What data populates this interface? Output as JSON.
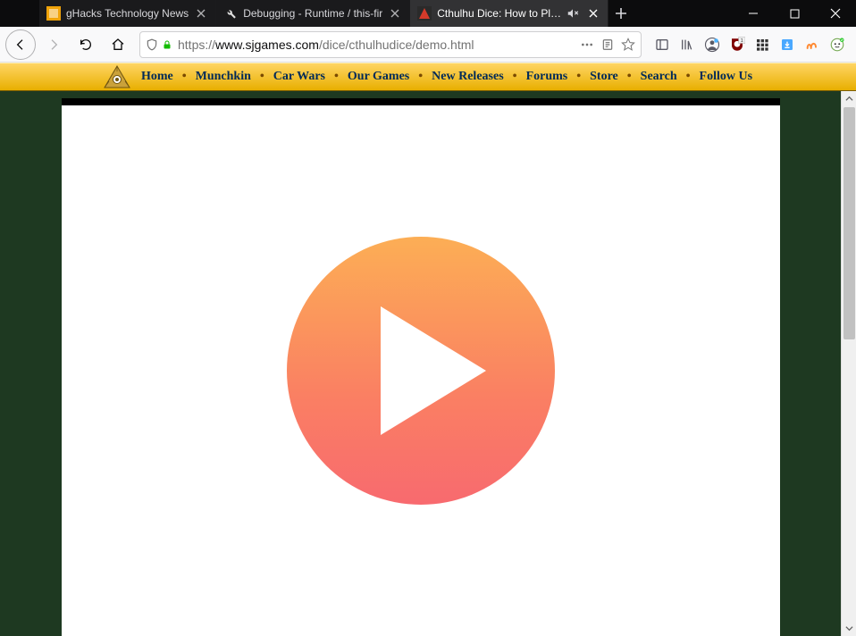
{
  "browser": {
    "tabs": [
      {
        "title": "gHacks Technology News",
        "active": false
      },
      {
        "title": "Debugging - Runtime / this-fir",
        "active": false
      },
      {
        "title": "Cthulhu Dice: How to Play",
        "active": true
      }
    ],
    "url_display": {
      "scheme": "https://",
      "host": "www.sjgames.com",
      "path": "/dice/cthulhudice/demo.html"
    },
    "extensions": [
      "reader",
      "library",
      "account",
      "ublock",
      "grid",
      "downloads",
      "gesture",
      "greasemonkey"
    ]
  },
  "site_nav": {
    "items": [
      "Home",
      "Munchkin",
      "Car Wars",
      "Our Games",
      "New Releases",
      "Forums",
      "Store",
      "Search",
      "Follow Us"
    ]
  },
  "video": {
    "state": "paused"
  }
}
